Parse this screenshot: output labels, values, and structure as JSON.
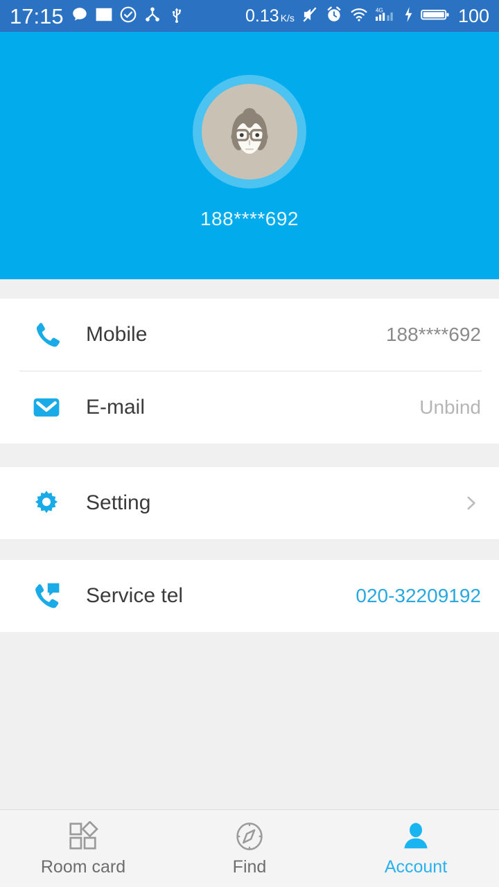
{
  "status_bar": {
    "time": "17:15",
    "net_speed_value": "0.13",
    "net_speed_unit": "K/s",
    "battery_percent": "100",
    "left_icons": [
      "message-icon",
      "photo-icon",
      "check-circle-icon",
      "share-icon",
      "usb-icon"
    ],
    "right_icons": [
      "mute-icon",
      "alarm-icon",
      "wifi-icon",
      "signal-4g-icon",
      "charging-bolt-icon",
      "battery-icon"
    ],
    "background_color": "#2b73c2"
  },
  "header": {
    "username": "188****692",
    "avatar_name": "user-avatar",
    "background_color": "#02abec",
    "ring_color": "#4cc3f0",
    "avatar_bg_color": "#c9c1b3"
  },
  "sections": [
    {
      "rows": [
        {
          "icon": "phone-icon",
          "label": "Mobile",
          "value": "188****692",
          "value_style": "normal",
          "chevron": false
        },
        {
          "icon": "email-icon",
          "label": "E-mail",
          "value": "Unbind",
          "value_style": "muted",
          "chevron": false
        }
      ]
    },
    {
      "rows": [
        {
          "icon": "gear-icon",
          "label": "Setting",
          "value": "",
          "value_style": "normal",
          "chevron": true
        }
      ]
    },
    {
      "rows": [
        {
          "icon": "support-phone-icon",
          "label": "Service tel",
          "value": "020-32209192",
          "value_style": "link",
          "chevron": false
        }
      ]
    }
  ],
  "bottom_nav": {
    "items": [
      {
        "icon": "room-card-icon",
        "label": "Room card",
        "active": false
      },
      {
        "icon": "compass-icon",
        "label": "Find",
        "active": false
      },
      {
        "icon": "person-icon",
        "label": "Account",
        "active": true
      }
    ],
    "active_color": "#29b0ef",
    "inactive_color": "#6d6d6d"
  }
}
